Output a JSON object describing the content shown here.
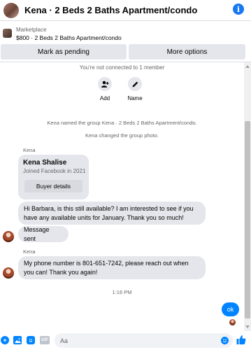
{
  "header": {
    "title": "Kena · 2 Beds 2 Baths Apartment/condo",
    "info_icon": "i"
  },
  "marketplace": {
    "label": "Marketplace",
    "price_line": "$800 · 2 Beds 2 Baths Apartment/condo"
  },
  "actions": {
    "pending": "Mark as pending",
    "more": "More options"
  },
  "conversation": {
    "not_connected": "You're not connected to 1 member",
    "quick_actions": {
      "add": "Add",
      "name": "Name"
    },
    "system_messages": [
      "Kena named the group Kena · 2 Beds 2 Baths Apartment/condo.",
      "Kena changed the group photo."
    ],
    "sender_name_1": "Kena",
    "profile_card": {
      "name": "Kena Shalise",
      "subtitle": "Joined Facebook in 2021",
      "button": "Buyer details"
    },
    "message_1": "Hi Barbara, is this still available? I am interested to see if you have any available units for January. Thank you so much!",
    "message_2": "Message sent",
    "sender_name_2": "Kena",
    "message_3": "My phone number is 801-651-7242, please reach out when you can! Thank you again!",
    "timestamp": "1:16 PM",
    "my_message": "ok"
  },
  "composer": {
    "placeholder": "Aa",
    "gif_label": "GIF"
  },
  "colors": {
    "accent": "#0084ff",
    "bubble": "#e4e6eb"
  }
}
